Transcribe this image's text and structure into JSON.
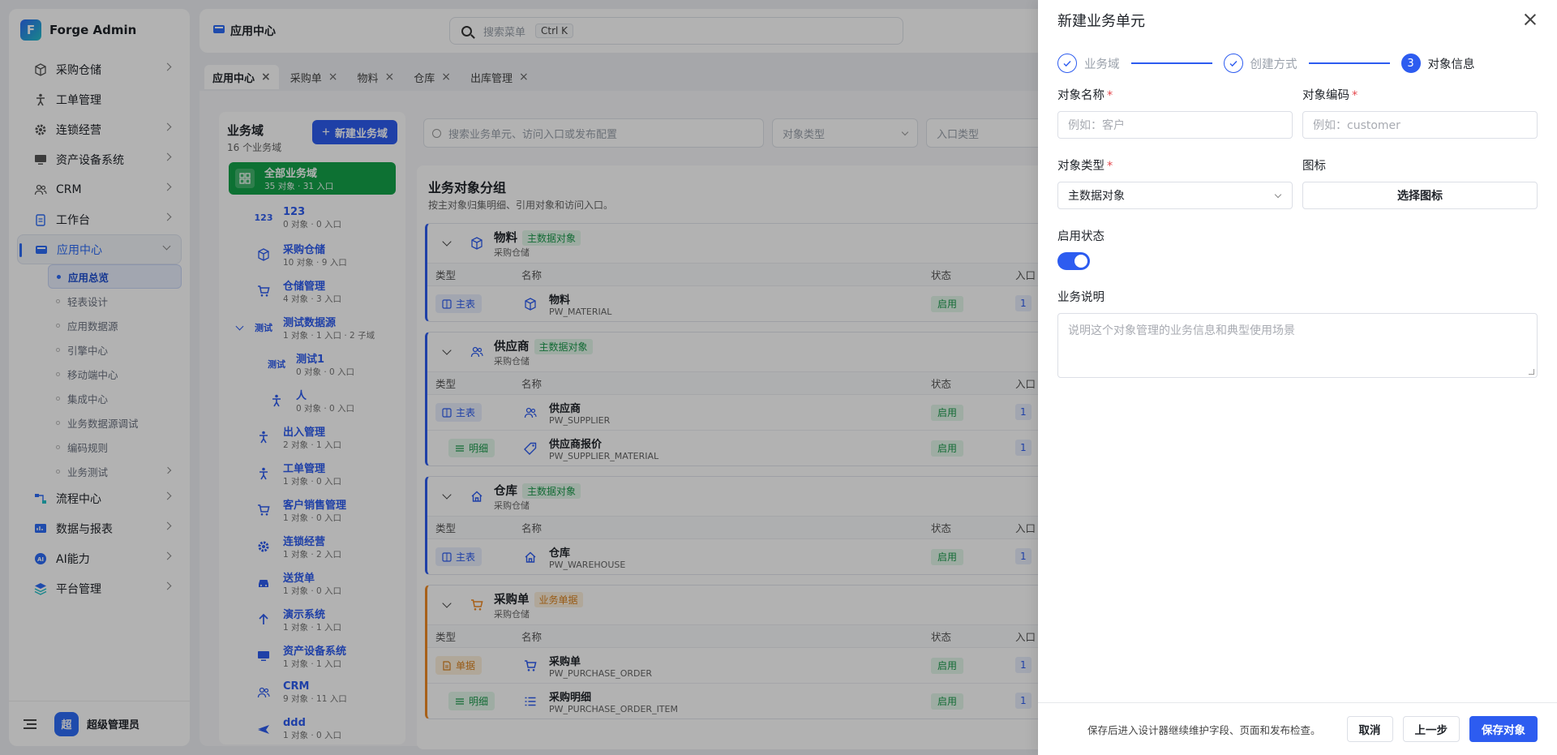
{
  "brand": {
    "name": "Forge Admin",
    "logo_letter": "F"
  },
  "topbar": {
    "crumb": "应用中心",
    "search_placeholder": "搜索菜单",
    "search_kbd": "Ctrl K"
  },
  "sidebar": {
    "items": [
      {
        "label": "采购仓储",
        "icon": "box-icon",
        "chev": true
      },
      {
        "label": "工单管理",
        "icon": "person-icon",
        "chev": false
      },
      {
        "label": "连锁经营",
        "icon": "gear-icon",
        "chev": true
      },
      {
        "label": "资产设备系统",
        "icon": "monitor-icon",
        "chev": true
      },
      {
        "label": "CRM",
        "icon": "users-icon",
        "chev": true
      },
      {
        "label": "工作台",
        "icon": "clipboard-icon",
        "chev": true
      },
      {
        "label": "应用中心",
        "icon": "app-icon",
        "chev": true,
        "open": true
      }
    ],
    "sub_items": [
      {
        "label": "应用总览",
        "active": true
      },
      {
        "label": "轻表设计"
      },
      {
        "label": "应用数据源"
      },
      {
        "label": "引擎中心"
      },
      {
        "label": "移动端中心"
      },
      {
        "label": "集成中心"
      },
      {
        "label": "业务数据源调试"
      },
      {
        "label": "编码规则"
      },
      {
        "label": "业务测试",
        "chev": true
      }
    ],
    "bottom_items": [
      {
        "label": "流程中心",
        "icon": "flow-icon"
      },
      {
        "label": "数据与报表",
        "icon": "report-icon"
      },
      {
        "label": "AI能力",
        "icon": "ai-icon"
      },
      {
        "label": "平台管理",
        "icon": "platform-icon"
      }
    ],
    "user": {
      "avatar": "超",
      "name": "超级管理员"
    }
  },
  "tabs": [
    {
      "label": "应用中心",
      "active": true
    },
    {
      "label": "采购单"
    },
    {
      "label": "物料"
    },
    {
      "label": "仓库"
    },
    {
      "label": "出库管理"
    }
  ],
  "domain_panel": {
    "title": "业务域",
    "count": "16 个业务域",
    "new_button": "新建业务域",
    "all": {
      "title": "全部业务域",
      "sub": "35 对象 · 31 入口"
    },
    "rows": [
      {
        "icon_text": "123",
        "title": "123",
        "sub": "0 对象 · 0 入口"
      },
      {
        "icon": "box-icon",
        "title": "采购仓储",
        "sub": "10 对象 · 9 入口"
      },
      {
        "icon": "cart-icon",
        "title": "仓储管理",
        "sub": "4 对象 · 3 入口"
      },
      {
        "icon_text": "测试",
        "title": "测试数据源",
        "sub": "1 对象 · 1 入口 · 2 子域",
        "expand": true
      },
      {
        "icon_text": "测试",
        "title": "测试1",
        "sub": "0 对象 · 0 入口",
        "child": true
      },
      {
        "icon": "person-icon",
        "title": "人",
        "sub": "0 对象 · 0 入口",
        "child": true
      },
      {
        "icon": "person-icon",
        "title": "出入管理",
        "sub": "2 对象 · 1 入口"
      },
      {
        "icon": "person-icon",
        "title": "工单管理",
        "sub": "1 对象 · 0 入口"
      },
      {
        "icon": "cart-icon",
        "title": "客户销售管理",
        "sub": "1 对象 · 0 入口"
      },
      {
        "icon": "gear-icon",
        "title": "连锁经营",
        "sub": "1 对象 · 2 入口"
      },
      {
        "icon": "car-icon",
        "title": "送货单",
        "sub": "1 对象 · 0 入口"
      },
      {
        "icon": "arrow-up-icon",
        "title": "演示系统",
        "sub": "1 对象 · 1 入口"
      },
      {
        "icon": "monitor-icon",
        "title": "资产设备系统",
        "sub": "1 对象 · 1 入口"
      },
      {
        "icon": "users-icon",
        "title": "CRM",
        "sub": "9 对象 · 11 入口"
      },
      {
        "icon": "plane-icon",
        "title": "ddd",
        "sub": "1 对象 · 0 入口"
      }
    ]
  },
  "filters": {
    "search_placeholder": "搜索业务单元、访问入口或发布配置",
    "type_placeholder": "对象类型",
    "entry_placeholder": "入口类型"
  },
  "groups": {
    "title": "业务对象分组",
    "subtitle": "按主对象归集明细、引用对象和访问入口。",
    "columns": {
      "type": "类型",
      "name": "名称",
      "status": "状态",
      "entry": "入口"
    },
    "cards": [
      {
        "color": "blue",
        "icon": "box-icon",
        "title": "物料",
        "badge": "主数据对象",
        "badge_color": "green",
        "domain": "采购仓储",
        "rows": [
          {
            "tag": "主表",
            "tag_kind": "main",
            "icon": "box-icon",
            "name": "物料",
            "code": "PW_MATERIAL",
            "status": "启用",
            "entry": "1"
          }
        ]
      },
      {
        "color": "blue",
        "icon": "users-icon",
        "title": "供应商",
        "badge": "主数据对象",
        "badge_color": "green",
        "domain": "采购仓储",
        "rows": [
          {
            "tag": "主表",
            "tag_kind": "main",
            "icon": "users-icon",
            "name": "供应商",
            "code": "PW_SUPPLIER",
            "status": "启用",
            "entry": "1"
          },
          {
            "tag": "明细",
            "tag_kind": "detail",
            "icon": "tag-icon",
            "name": "供应商报价",
            "code": "PW_SUPPLIER_MATERIAL",
            "status": "启用",
            "entry": "1"
          }
        ]
      },
      {
        "color": "blue",
        "icon": "house-icon",
        "title": "仓库",
        "badge": "主数据对象",
        "badge_color": "green",
        "domain": "采购仓储",
        "rows": [
          {
            "tag": "主表",
            "tag_kind": "main",
            "icon": "house-icon",
            "name": "仓库",
            "code": "PW_WAREHOUSE",
            "status": "启用",
            "entry": "1"
          }
        ]
      },
      {
        "color": "orange",
        "icon": "cart-icon",
        "title": "采购单",
        "badge": "业务单据",
        "badge_color": "orange",
        "domain": "采购仓储",
        "rows": [
          {
            "tag": "单据",
            "tag_kind": "doc",
            "icon": "cart-icon",
            "name": "采购单",
            "code": "PW_PURCHASE_ORDER",
            "status": "启用",
            "entry": "1"
          },
          {
            "tag": "明细",
            "tag_kind": "detail",
            "icon": "list-icon",
            "name": "采购明细",
            "code": "PW_PURCHASE_ORDER_ITEM",
            "status": "启用",
            "entry": "1"
          }
        ]
      }
    ]
  },
  "drawer": {
    "title": "新建业务单元",
    "steps": [
      {
        "label": "业务域",
        "done": true
      },
      {
        "label": "创建方式",
        "done": true
      },
      {
        "num": "3",
        "label": "对象信息",
        "current": true
      }
    ],
    "fields": {
      "name_label": "对象名称",
      "name_placeholder": "例如：客户",
      "code_label": "对象编码",
      "code_placeholder": "例如：customer",
      "type_label": "对象类型",
      "type_value": "主数据对象",
      "icon_label": "图标",
      "icon_button": "选择图标",
      "enabled_label": "启用状态",
      "enabled": true,
      "desc_label": "业务说明",
      "desc_placeholder": "说明这个对象管理的业务信息和典型使用场景"
    },
    "footer": {
      "hint": "保存后进入设计器继续维护字段、页面和发布检查。",
      "cancel": "取消",
      "prev": "上一步",
      "save": "保存对象"
    }
  },
  "colors": {
    "primary": "#2d5cf0",
    "success": "#14a34a",
    "warning": "#f08a24"
  }
}
